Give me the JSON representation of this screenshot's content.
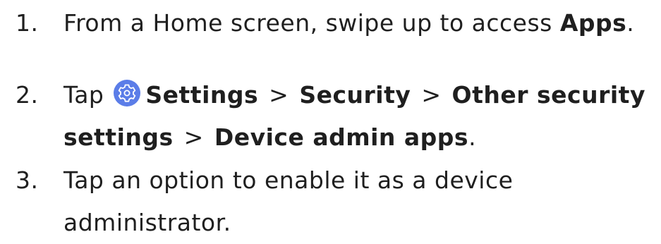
{
  "steps": [
    {
      "number": "1.",
      "text": "From a Home screen, swipe up to access ",
      "bold": "Apps",
      "end": "."
    },
    {
      "number": "2.",
      "tap": "Tap",
      "settings": "Settings",
      "separator": ">",
      "security": "Security",
      "other_security": "Other security",
      "settings_word": "settings",
      "device_admin": "Device admin apps",
      "end": "."
    },
    {
      "number": "3.",
      "line1": "Tap an option to enable it as a device",
      "line2": "administrator."
    }
  ],
  "icon": {
    "name": "settings-gear-icon",
    "color": "#5b7de8"
  }
}
